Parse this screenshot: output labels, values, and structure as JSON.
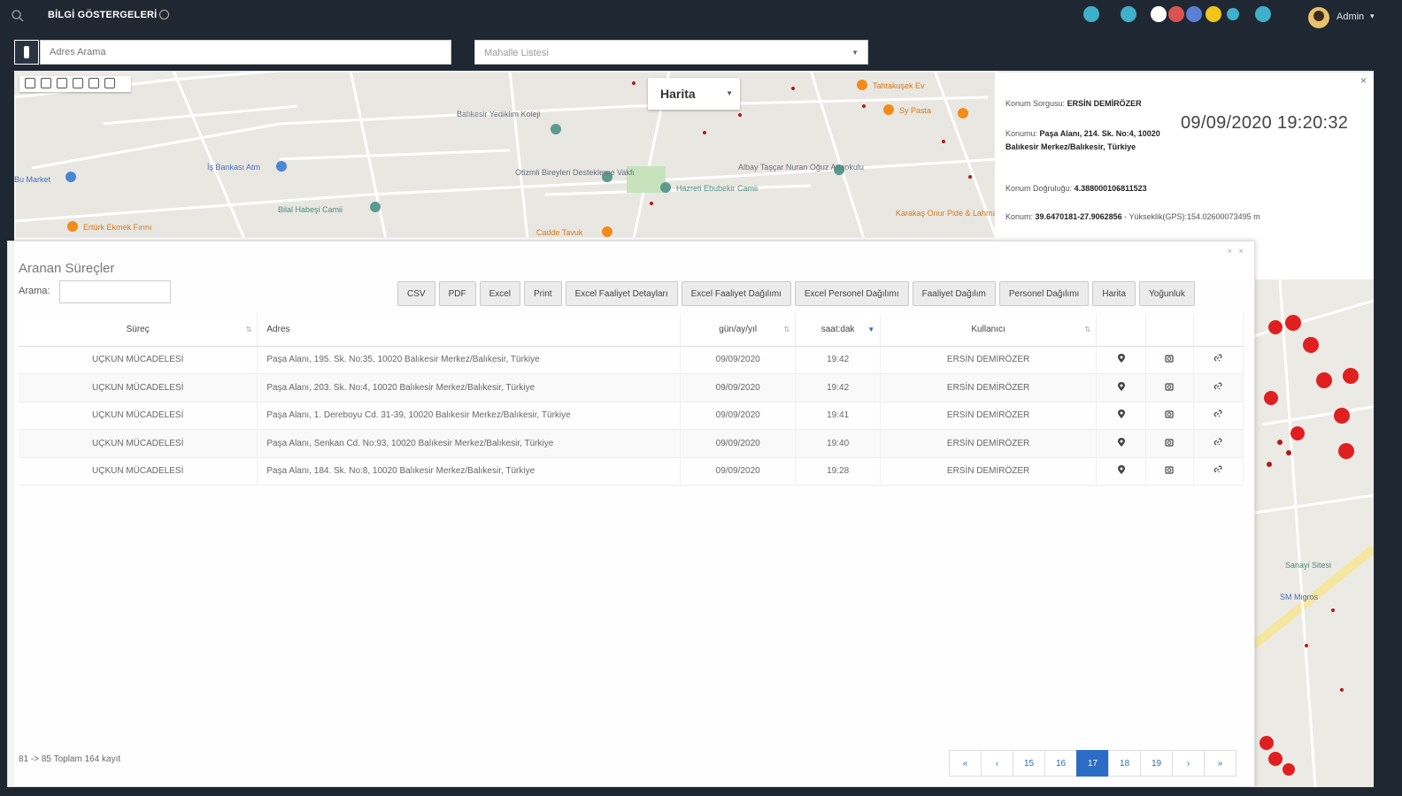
{
  "topbar": {
    "title": "BİLGİ GÖSTERGELERİ",
    "user_name": "Admin",
    "badges": [
      {
        "icon": "chat-icon",
        "color": "#3fb0c9"
      },
      {
        "icon": "chat-icon",
        "color": "#3fb0c9"
      },
      {
        "icon": "message-icon",
        "color": "#ffffff"
      },
      {
        "icon": "notification-icon",
        "color": "#d9534f"
      },
      {
        "icon": "mail-icon",
        "color": "#5b7fd6"
      },
      {
        "icon": "alert-icon",
        "color": "#f0c419"
      },
      {
        "icon": "info-icon",
        "color": "#3fb0c9"
      },
      {
        "icon": "search-user-icon",
        "color": "#3fb0c9"
      }
    ]
  },
  "search": {
    "address_placeholder": "Adres Arama",
    "neighborhood_placeholder": "Mahalle Listesi"
  },
  "map": {
    "type_selector": "Harita",
    "labels": [
      "Balıkesir Yediklim Koleji",
      "İş Bankası Atm",
      "Bilal Habeşi Camii",
      "Ertürk Ekmek Fırını",
      "Otizmli Bireyleri Destekleme Vakfı",
      "Hazreti Ebubekir Camii",
      "Albay Taşçar Nuran Oğuz Anaokulu",
      "Tahtakuşek Ev",
      "Sy Pasta",
      "Karakaş Onur Pide & Lahmacun",
      "Cadde Tavuk",
      "Sanayi Sitesi",
      "SM Migros",
      "Bu Market"
    ]
  },
  "info": {
    "konum_label": "Konum Sorgusu:",
    "konum_value": "ERSİN DEMİRÖZER",
    "konumu_label": "Konumu:",
    "konumu_value": "Paşa Alanı, 214. Sk. No:4, 10020 Balıkesir Merkez/Balıkesir, Türkiye",
    "dogruluk_label": "Konum Doğruluğu:",
    "dogruluk_value": "4.388000106811523",
    "coord_label": "Konum:",
    "coord_value": "39.6470181-27.9062856",
    "altitude_text": "Yükseklik(GPS):154.02600073495 m",
    "timestamp": "09/09/2020 19:20:32"
  },
  "dialog": {
    "title": "Aranan Süreçler",
    "search_label": "Arama:",
    "buttons": [
      "CSV",
      "PDF",
      "Excel",
      "Print",
      "Excel Faaliyet Detayları",
      "Excel Faaliyet Dağılımı",
      "Excel Personel Dağılımı",
      "Faaliyet Dağılım",
      "Personel Dağılımı",
      "Harita",
      "Yoğunluk"
    ],
    "columns": [
      "Süreç",
      "Adres",
      "gün/ay/yıl",
      "saat:dak",
      "Kullanıcı"
    ],
    "rows": [
      {
        "surec": "UÇKUN MÜCADELESİ",
        "adres": "Paşa Alanı, 195. Sk. No:35, 10020 Balıkesir Merkez/Balıkesir, Türkiye",
        "tarih": "09/09/2020",
        "saat": "19:42",
        "kullanici": "ERSİN DEMİRÖZER"
      },
      {
        "surec": "UÇKUN MÜCADELESİ",
        "adres": "Paşa Alanı, 203. Sk. No:4, 10020 Balıkesir Merkez/Balıkesir, Türkiye",
        "tarih": "09/09/2020",
        "saat": "19:42",
        "kullanici": "ERSİN DEMİRÖZER"
      },
      {
        "surec": "UÇKUN MÜCADELESİ",
        "adres": "Paşa Alanı, 1. Dereboyu Cd. 31-39, 10020 Balıkesir Merkez/Balıkesir, Türkiye",
        "tarih": "09/09/2020",
        "saat": "19:41",
        "kullanici": "ERSİN DEMİRÖZER"
      },
      {
        "surec": "UÇKUN MÜCADELESİ",
        "adres": "Paşa Alanı, Senkan Cd. No:93, 10020 Balıkesir Merkez/Balıkesir, Türkiye",
        "tarih": "09/09/2020",
        "saat": "19:40",
        "kullanici": "ERSİN DEMİRÖZER"
      },
      {
        "surec": "UÇKUN MÜCADELESİ",
        "adres": "Paşa Alanı, 184. Sk. No:8, 10020 Balıkesir Merkez/Balıkesir, Türkiye",
        "tarih": "09/09/2020",
        "saat": "19:28",
        "kullanici": "ERSİN DEMİRÖZER"
      }
    ],
    "footer": "81 -> 85 Toplam 164 kayıt",
    "pager": [
      "«",
      "‹",
      "15",
      "16",
      "17",
      "18",
      "19",
      "›",
      "»"
    ],
    "active_page": "17"
  }
}
